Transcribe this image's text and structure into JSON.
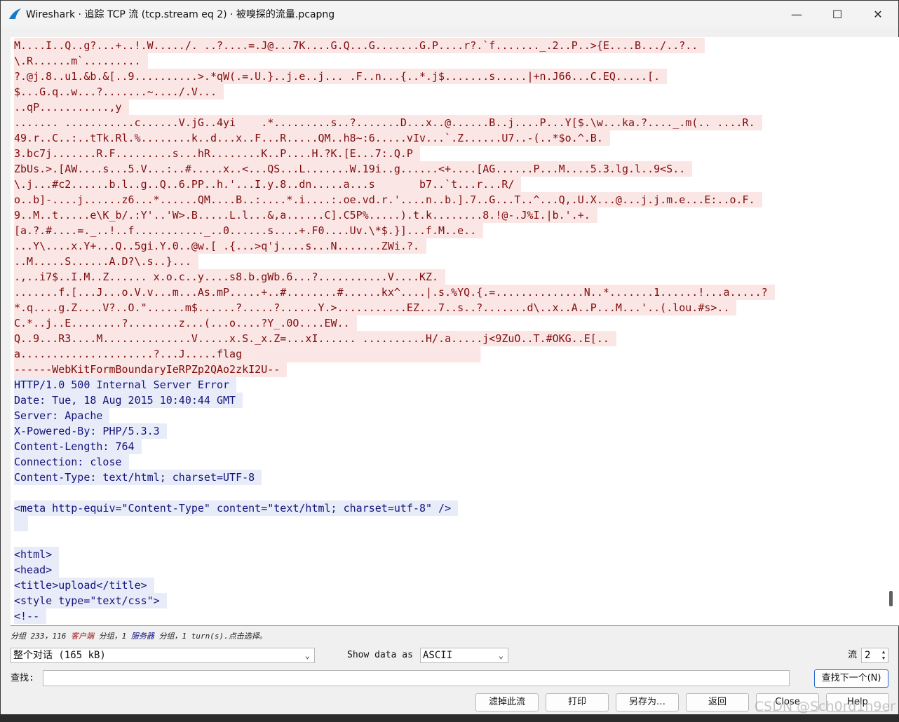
{
  "window": {
    "title": "Wireshark · 追踪 TCP 流 (tcp.stream eq 2) · 被嗅探的流量.pcapng",
    "minimize_glyph": "—",
    "maximize_glyph": "☐",
    "close_glyph": "✕"
  },
  "stream": {
    "lines": [
      {
        "dir": "client",
        "text": "M....I..Q..g?...+..!.W...../. ..?....=.J@...7K....G.Q...G.......G.P....r?.`f......._.2..P..>{E....B.../..?.."
      },
      {
        "dir": "client",
        "text": "\\.R......m`........."
      },
      {
        "dir": "client",
        "text": "?.@j.8..u1.&b.&[..9..........>.*qW(.=.U.}..j.e..j... .F..n...{..*.j$.......s.....|+n.J66...C.EQ.....[."
      },
      {
        "dir": "client",
        "text": "$...G.q..w...?.......~..../.V..."
      },
      {
        "dir": "client",
        "text": "..qP...........,y"
      },
      {
        "dir": "client",
        "text": "....... ...........c......V.jG..4yi    .*.........s..?.......D...x..@......B..j....P...Y[$.\\w...ka.?...._.m(.. ....R."
      },
      {
        "dir": "client",
        "text": "49.r..C..:..tTk.Rl.%........k..d...x..F...R.....QM..h8~:6.....vIv...`.Z......U7..-(..*$o.^.B."
      },
      {
        "dir": "client",
        "text": "3.bc7j.......R.F.........s...hR........K..P....H.?K.[E...7:.Q.P"
      },
      {
        "dir": "client",
        "text": "ZbUs.>.[AW....s...5.V...:..#.....x..<...QS...L.......W.19i..g......<+....[AG......P...M....5.3.lg.l..9<S.."
      },
      {
        "dir": "client",
        "text": "\\.j...#c2......b.l..g..Q..6.PP..h.'...I.y.8..dn.....a...s       b7..`t...r...R/"
      },
      {
        "dir": "client",
        "text": "o..b]-....j......z6...*......QM....B..:....*.i....:.oe.vd.r.'....n..b.].7..G...T..^...Q,.U.X...@...j.j.m.e...E:..o.F."
      },
      {
        "dir": "client",
        "text": "9..M..t.....e\\K_b/.:Y'..'W>.B.....L.l...&,a......C].C5P%.....).t.k........8.!@-.J%I.|b.'.+."
      },
      {
        "dir": "client",
        "text": "[a.?.#....=._..!..f..........._..0......s....+.F0....Uv.\\*$.}]...f.M..e.."
      },
      {
        "dir": "client",
        "text": "...Y\\....x.Y+...Q..5gi.Y.0..@w.[ .{...>q'j....s...N.......ZWi.?."
      },
      {
        "dir": "client",
        "text": "..M.....S......A.D?\\.s..}..."
      },
      {
        "dir": "client",
        "text": ".,..i7$..I.M..Z...... x.o.c..y....s8.b.gWb.6...?...........V....KZ."
      },
      {
        "dir": "client",
        "text": ".......f.[...J...o.V.v...m...As.mP.....+..#........#......kx^....|.s.%YQ.{.=..............N..*.......1......!...a.....?"
      },
      {
        "dir": "client",
        "text": "*.q....g.Z....V?..O.\"......m$......?.....?......Y.>...........EZ...7..s..?.......d\\..x..A..P...M...'..(.lou.#s>.."
      },
      {
        "dir": "client",
        "text": "C.*..j..E........?........z...(...o....?Y_.0O....EW.."
      },
      {
        "dir": "client",
        "text": "Q..9...R3....M..............V.....x.S._x.Z=...xI...... ..........H/.a.....j<9ZuO..T.#OKG..E[.."
      },
      {
        "dir": "client",
        "text": "a.....................?...J.....flag",
        "redacted": true
      },
      {
        "dir": "client",
        "text": "------WebKitFormBoundaryIeRPZp2QAo2zkI2U--"
      },
      {
        "dir": "server",
        "text": "HTTP/1.0 500 Internal Server Error"
      },
      {
        "dir": "server",
        "text": "Date: Tue, 18 Aug 2015 10:40:44 GMT"
      },
      {
        "dir": "server",
        "text": "Server: Apache"
      },
      {
        "dir": "server",
        "text": "X-Powered-By: PHP/5.3.3"
      },
      {
        "dir": "server",
        "text": "Content-Length: 764"
      },
      {
        "dir": "server",
        "text": "Connection: close"
      },
      {
        "dir": "server",
        "text": "Content-Type: text/html; charset=UTF-8"
      },
      {
        "dir": "none",
        "text": ""
      },
      {
        "dir": "server",
        "text": "<meta http-equiv=\"Content-Type\" content=\"text/html; charset=utf-8\" />"
      },
      {
        "dir": "server",
        "text": "",
        "blank": true
      },
      {
        "dir": "none",
        "text": ""
      },
      {
        "dir": "server",
        "text": "<html>"
      },
      {
        "dir": "server",
        "text": "<head>"
      },
      {
        "dir": "server",
        "text": "<title>upload</title>"
      },
      {
        "dir": "server",
        "text": "<style type=\"text/css\">"
      },
      {
        "dir": "server",
        "text": "<!--"
      }
    ]
  },
  "status": {
    "prefix": "分组 233，116 ",
    "client_word": "客户端",
    "middle": " 分组，1 ",
    "server_word": "服务器",
    "suffix": " 分组，1 turn(s).点击选择。"
  },
  "controls": {
    "conversation_select": "整个对话 (165 kB)",
    "show_data_as_label": "Show data as",
    "show_data_as_value": "ASCII",
    "stream_label": "流",
    "stream_value": "2",
    "find_label": "查找:",
    "find_value": "",
    "find_next_button": "查找下一个(N)"
  },
  "buttons": {
    "filter_out": "滤掉此流",
    "print": "打印",
    "save_as": "另存为…",
    "back": "返回",
    "close": "Close",
    "help": "Help"
  },
  "watermark": "CSDN @Sch0rd1n9er"
}
